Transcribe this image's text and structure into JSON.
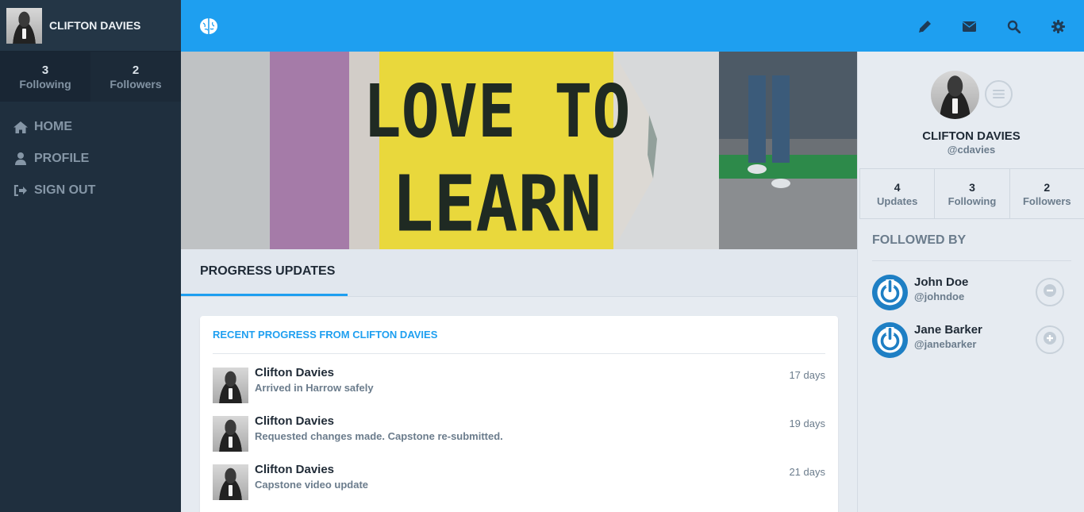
{
  "sidebar": {
    "user_name": "CLIFTON DAVIES",
    "stats": [
      {
        "num": "3",
        "label": "Following"
      },
      {
        "num": "2",
        "label": "Followers"
      }
    ],
    "nav": [
      {
        "label": "HOME",
        "icon": "home-icon"
      },
      {
        "label": "PROFILE",
        "icon": "user-icon"
      },
      {
        "label": "SIGN OUT",
        "icon": "sign-out-icon"
      }
    ]
  },
  "topbar": {
    "icons": [
      "brain-logo-icon",
      "pencil-icon",
      "envelope-icon",
      "search-icon",
      "gear-icon"
    ]
  },
  "hero": {
    "sign_line1": "LOVE TO",
    "sign_line2": "LEARN"
  },
  "tabs": {
    "active": "PROGRESS UPDATES"
  },
  "feed": {
    "title": "RECENT PROGRESS FROM CLIFTON DAVIES",
    "items": [
      {
        "name": "Clifton Davies",
        "text": "Arrived in Harrow safely",
        "time": "17 days"
      },
      {
        "name": "Clifton Davies",
        "text": "Requested changes made. Capstone re-submitted.",
        "time": "19 days"
      },
      {
        "name": "Clifton Davies",
        "text": "Capstone video update",
        "time": "21 days"
      }
    ]
  },
  "profile": {
    "name": "CLIFTON DAVIES",
    "handle": "@cdavies",
    "stats": [
      {
        "num": "4",
        "label": "Updates"
      },
      {
        "num": "3",
        "label": "Following"
      },
      {
        "num": "2",
        "label": "Followers"
      }
    ],
    "followed_by_title": "FOLLOWED BY",
    "followed_by": [
      {
        "name": "John Doe",
        "handle": "@johndoe",
        "action": "minus-circle-icon"
      },
      {
        "name": "Jane Barker",
        "handle": "@janebarker",
        "action": "plus-circle-icon"
      }
    ]
  },
  "colors": {
    "accent": "#1e9ff0",
    "sidebar_bg": "#1f2f3e",
    "muted_text": "#6b7c8c",
    "sign_yellow": "#ecd93a"
  }
}
